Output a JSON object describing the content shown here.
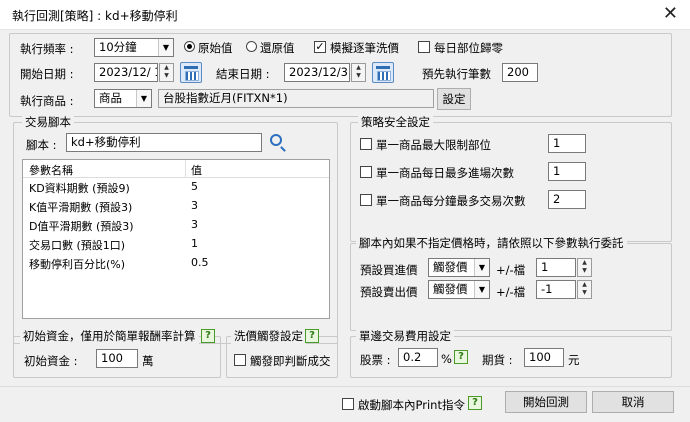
{
  "window": {
    "title": "執行回測[策略] : kd+移動停利",
    "close": "✕"
  },
  "top": {
    "freq_label": "執行頻率 :",
    "freq_value": "10分鐘",
    "radio_original": "原始值",
    "radio_restore": "還原值",
    "simulate_label": "模擬逐筆洗價",
    "simulate_checked": true,
    "daily_zero_label": "每日部位歸零",
    "daily_zero_checked": false,
    "start_label": "開始日期 :",
    "start_value": "2023/12/ 1",
    "end_label": "結束日期 :",
    "end_value": "2023/12/31",
    "precount_label": "預先執行筆數",
    "precount_value": "200",
    "product_label": "執行商品 :",
    "product_type": "商品",
    "product_name": "台股指數近月(FITXN*1)",
    "set_button": "設定"
  },
  "script_group": {
    "title": "交易腳本",
    "script_label": "腳本 :",
    "script_value": "kd+移動停利",
    "columns": [
      "參數名稱",
      "值"
    ],
    "rows": [
      {
        "name": "KD資料期數 (預設9)",
        "value": "5"
      },
      {
        "name": "K值平滑期數 (預設3)",
        "value": "3"
      },
      {
        "name": "D值平滑期數 (預設3)",
        "value": "3"
      },
      {
        "name": "交易口數 (預設1口)",
        "value": "1"
      },
      {
        "name": "移動停利百分比(%)",
        "value": "0.5"
      }
    ]
  },
  "safety": {
    "title": "策略安全設定",
    "items": [
      {
        "label": "單一商品最大限制部位",
        "value": "1"
      },
      {
        "label": "單一商品每日最多進場次數",
        "value": "1"
      },
      {
        "label": "單一商品每分鐘最多交易次數",
        "value": "2"
      }
    ]
  },
  "price": {
    "title": "腳本內如果不指定價格時，請依照以下參數執行委託",
    "buy_label": "預設買進價",
    "buy_type": "觸發價",
    "buy_tick": "1",
    "sell_label": "預設賣出價",
    "sell_type": "觸發價",
    "sell_tick": "-1",
    "tick_unit": "+/-檔"
  },
  "capital": {
    "title": "初始資金，僅用於簡單報酬率計算",
    "label": "初始資金 :",
    "value": "100",
    "unit": "萬"
  },
  "wash": {
    "title": "洗價觸發設定",
    "label": "觸發即判斷成交"
  },
  "fee": {
    "title": "單邊交易費用設定",
    "stock_label": "股票 :",
    "stock_value": "0.2",
    "stock_unit": "%",
    "futures_label": "期貨 :",
    "futures_value": "100",
    "futures_unit": "元"
  },
  "bottom": {
    "print_label": "啟動腳本內Print指令",
    "start_button": "開始回測",
    "cancel_button": "取消"
  },
  "help_glyph": "?",
  "colors": {
    "dialog_bg": "#f0f0f0",
    "help_green": "#4a9a2a",
    "calendar_blue": "#2f6db5"
  }
}
